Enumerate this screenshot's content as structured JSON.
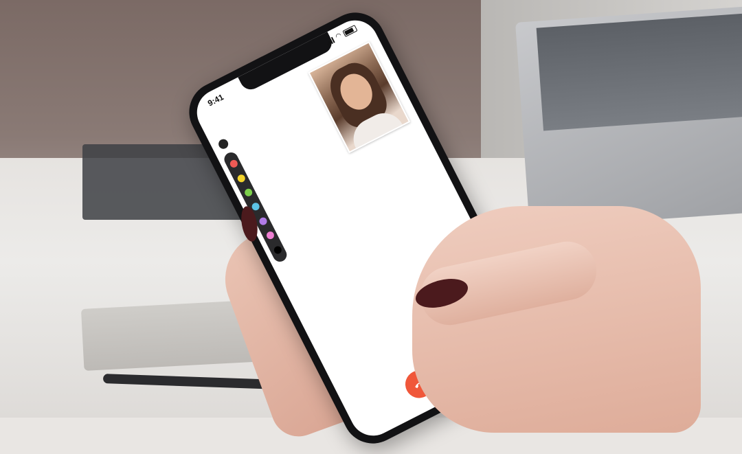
{
  "status_bar": {
    "time": "9:41"
  },
  "palette": {
    "colors": [
      "#ef5a55",
      "#f3d42c",
      "#7cd04b",
      "#5cc3e6",
      "#b07be7",
      "#ee7fd2"
    ]
  },
  "call_controls": {
    "end_button_color": "#f0573a",
    "video_button_color": "#fbd9c7",
    "video_icon_color": "#f0712f",
    "icons": [
      "end-call-icon",
      "video-camera-icon"
    ]
  },
  "remote_video": {
    "icon": "video-preview"
  }
}
